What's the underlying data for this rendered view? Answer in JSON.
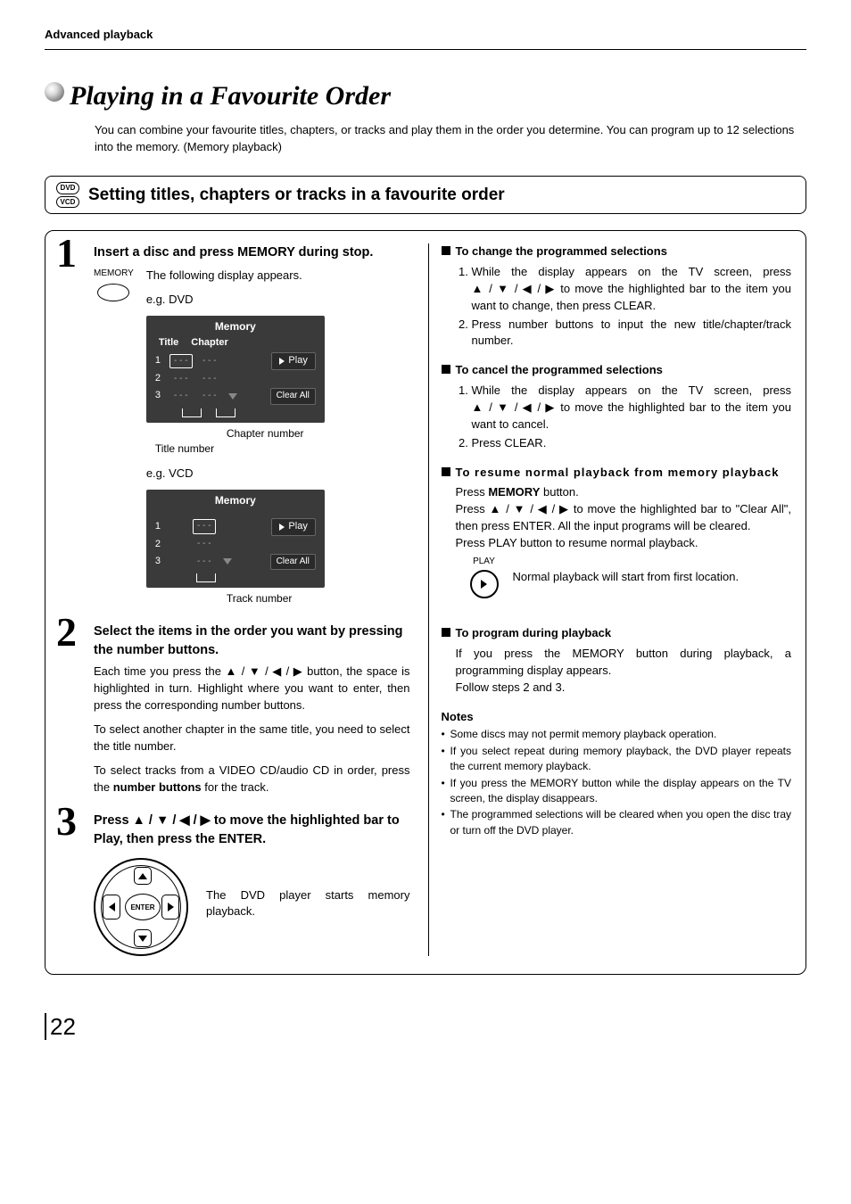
{
  "breadcrumb": "Advanced playback",
  "page_title": "Playing in a Favourite Order",
  "intro": "You can combine your favourite titles, chapters, or tracks and play them in the order you determine. You can program up to 12 selections into the memory. (Memory playback)",
  "disc_icons": {
    "dvd": "DVD",
    "vcd": "VCD"
  },
  "section_title": "Setting titles, chapters or tracks in a favourite order",
  "steps": {
    "s1": {
      "num": "1",
      "title": "Insert a disc and press MEMORY during stop.",
      "memory_label": "MEMORY",
      "following": "The following display appears.",
      "eg_dvd": "e.g.   DVD",
      "eg_vcd": "e.g.   VCD",
      "osd_title": "Memory",
      "osd_col_title": "Title",
      "osd_col_chapter": "Chapter",
      "osd_play": "Play",
      "osd_clear": "Clear All",
      "osd_row1": "1",
      "osd_row2": "2",
      "osd_row3": "3",
      "osd_placeholder": "- - -",
      "annot_chapter": "Chapter number",
      "annot_title": "Title number",
      "annot_track": "Track number"
    },
    "s2": {
      "num": "2",
      "title": "Select the items in the order you want by pressing the number buttons.",
      "p1a": "Each time you press the ",
      "p1b": " button, the space is highlighted in turn. Highlight where you want to enter, then press the corresponding number buttons.",
      "p2": "To select another chapter in the same title, you need to select the title number.",
      "p3a": "To select tracks from a VIDEO CD/audio CD in order, press the ",
      "p3b": "number buttons",
      "p3c": " for the track."
    },
    "s3": {
      "num": "3",
      "title_a": "Press ",
      "title_b": " to move the highlighted bar to Play, then press the ENTER.",
      "enter_label": "ENTER",
      "p1": "The DVD player starts memory playback."
    }
  },
  "right": {
    "change": {
      "head": "To change the programmed selections",
      "li1a": "While the display appears on the TV screen, press ",
      "li1b": " to move the highlighted bar to the item you want to change, then press CLEAR.",
      "li2": "Press number buttons to input the new title/chapter/track number."
    },
    "cancel": {
      "head": "To cancel the programmed selections",
      "li1a": "While the display appears on the TV screen, press ",
      "li1b": " to move the highlighted bar to the item you want to cancel.",
      "li2": "Press CLEAR."
    },
    "resume": {
      "head": "To resume normal playback from memory playback",
      "p1a": "Press ",
      "p1b": "MEMORY",
      "p1c": " button.",
      "p2a": "Press ",
      "p2b": " to move the highlighted bar to \"Clear All\", then press ENTER. All the input programs will be cleared.",
      "p3": "Press PLAY button to resume normal playback.",
      "play_label": "PLAY",
      "p4": "Normal playback will start from first location."
    },
    "program": {
      "head": "To program during playback",
      "p1": "If you press the MEMORY button during playback, a programming display appears.",
      "p2": "Follow steps 2 and 3."
    },
    "notes_head": "Notes",
    "notes": {
      "n1": "Some discs may not permit memory playback operation.",
      "n2": "If you select repeat during memory playback, the DVD player repeats the current memory playback.",
      "n3": "If you press the MEMORY button while the display appears on the TV screen, the display disappears.",
      "n4": "The programmed selections will be cleared when you open the disc tray or turn off the DVD player."
    }
  },
  "arrows_text": "▲ / ▼ / ◀ / ▶",
  "page_number": "22"
}
